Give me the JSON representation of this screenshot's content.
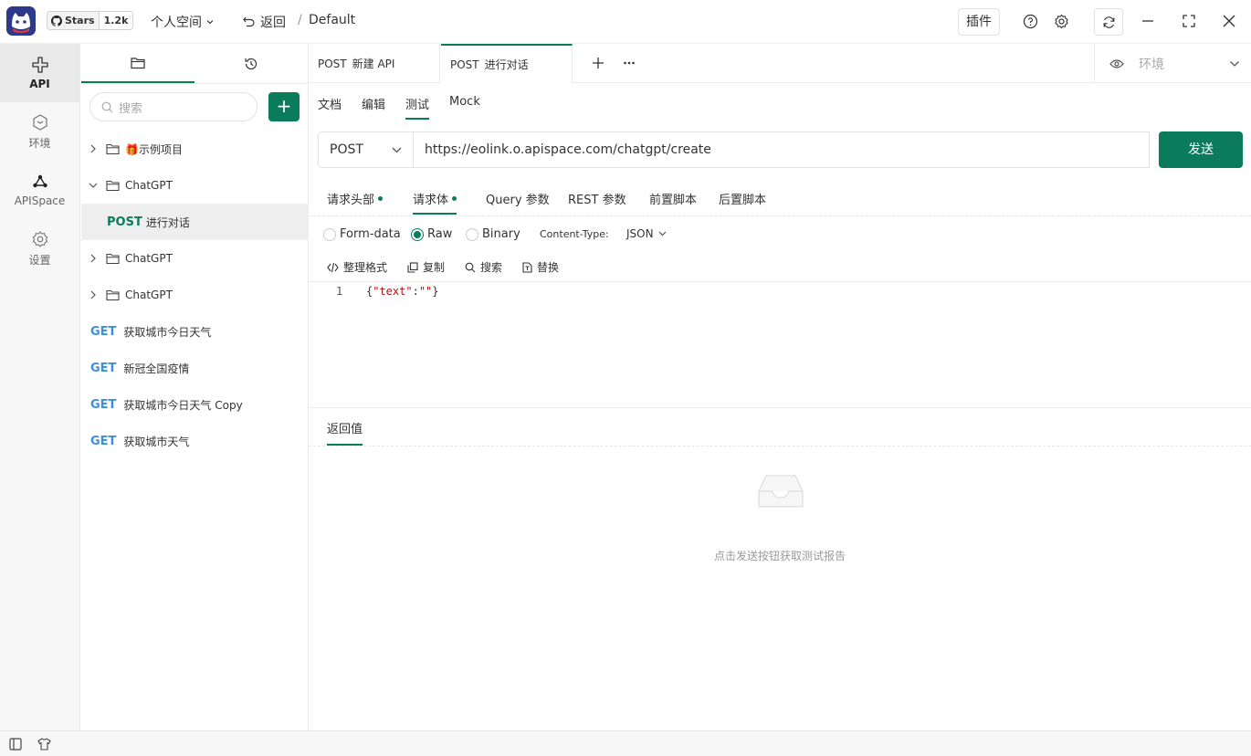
{
  "topbar": {
    "github_stars_label": "Stars",
    "github_stars_count": "1.2k",
    "workspace": "个人空间",
    "back": "返回",
    "separator": "/",
    "project": "Default",
    "plugin": "插件"
  },
  "leftnav": {
    "items": [
      {
        "label": "API",
        "icon": "api-icon"
      },
      {
        "label": "环境",
        "icon": "environment-icon"
      },
      {
        "label": "APISpace",
        "icon": "apispace-icon"
      },
      {
        "label": "设置",
        "icon": "settings-icon"
      }
    ]
  },
  "sidebar": {
    "search_placeholder": "搜索",
    "add": "+",
    "tree": [
      {
        "type": "folder",
        "label": "🎁示例项目",
        "expanded": false
      },
      {
        "type": "folder",
        "label": "ChatGPT",
        "expanded": true
      },
      {
        "type": "api",
        "method": "POST",
        "label": "进行对话",
        "selected": true
      },
      {
        "type": "folder",
        "label": "ChatGPT",
        "expanded": false
      },
      {
        "type": "folder",
        "label": "ChatGPT",
        "expanded": false
      },
      {
        "type": "api",
        "method": "GET",
        "label": "获取城市今日天气"
      },
      {
        "type": "api",
        "method": "GET",
        "label": "新冠全国疫情"
      },
      {
        "type": "api",
        "method": "GET",
        "label": "获取城市今日天气 Copy"
      },
      {
        "type": "api",
        "method": "GET",
        "label": "获取城市天气"
      }
    ]
  },
  "tabs": [
    {
      "method": "POST",
      "label": "新建 API"
    },
    {
      "method": "POST",
      "label": "进行对话",
      "active": true
    }
  ],
  "environment": {
    "placeholder": "环境"
  },
  "subtabs": [
    "文档",
    "编辑",
    "测试",
    "Mock"
  ],
  "request": {
    "method": "POST",
    "url": "https://eolink.o.apispace.com/chatgpt/create",
    "send": "发送"
  },
  "request_tabs": [
    {
      "label": "请求头部",
      "dot": true
    },
    {
      "label": "请求体",
      "dot": true,
      "active": true
    },
    {
      "label": "Query 参数"
    },
    {
      "label": "REST 参数"
    },
    {
      "label": "前置脚本"
    },
    {
      "label": "后置脚本"
    }
  ],
  "body": {
    "types": [
      "Form-data",
      "Raw",
      "Binary"
    ],
    "selected": "Raw",
    "content_type_label": "Content-Type:",
    "content_type_value": "JSON"
  },
  "tools": [
    "整理格式",
    "复制",
    "搜索",
    "替换"
  ],
  "code": {
    "line_no": "1",
    "open": "{",
    "key": "\"text\"",
    "colon": ":",
    "value": "\"\"",
    "close": "}"
  },
  "response": {
    "tab": "返回值",
    "empty": "点击发送按钮获取测试报告"
  },
  "colors": {
    "accent": "#0a7c5c",
    "get": "#3b8fe0"
  }
}
